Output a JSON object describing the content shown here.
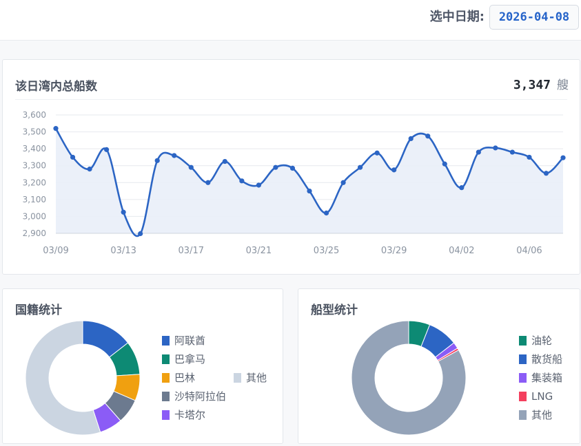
{
  "header": {
    "date_label": "选中日期:",
    "date_value": "2026-04-08"
  },
  "main_panel": {
    "title": "该日湾内总船数",
    "count": "3,347",
    "count_unit": "艘"
  },
  "nationality_panel": {
    "title": "国籍统计",
    "legend": [
      {
        "label": "阿联酋",
        "color": "#2c65c4"
      },
      {
        "label": "巴拿马",
        "color": "#0d8a74"
      },
      {
        "label": "巴林",
        "color": "#f0a010"
      },
      {
        "label": "沙特阿拉伯",
        "color": "#6c7a8f"
      },
      {
        "label": "卡塔尔",
        "color": "#8b5cf6"
      },
      {
        "label": "其他",
        "color": "#cbd5e1"
      }
    ]
  },
  "type_panel": {
    "title": "船型统计",
    "legend": [
      {
        "label": "油轮",
        "color": "#0d8a74"
      },
      {
        "label": "散货船",
        "color": "#2c65c4"
      },
      {
        "label": "集装箱",
        "color": "#8b5cf6"
      },
      {
        "label": "LNG",
        "color": "#f43f5e"
      },
      {
        "label": "其他",
        "color": "#94a3b8"
      }
    ]
  },
  "chart_data": [
    {
      "type": "area",
      "title": "该日湾内总船数",
      "x": [
        "03/09",
        "03/10",
        "03/11",
        "03/12",
        "03/13",
        "03/14",
        "03/15",
        "03/16",
        "03/17",
        "03/18",
        "03/19",
        "03/20",
        "03/21",
        "03/22",
        "03/23",
        "03/24",
        "03/25",
        "03/26",
        "03/27",
        "03/28",
        "03/29",
        "03/30",
        "03/31",
        "04/01",
        "04/02",
        "04/03",
        "04/04",
        "04/05",
        "04/06",
        "04/07",
        "04/08"
      ],
      "x_tick_labels": [
        "03/09",
        "03/13",
        "03/17",
        "03/21",
        "03/25",
        "03/29",
        "04/02",
        "04/06"
      ],
      "y_tick_labels": [
        "2,900",
        "3,000",
        "3,100",
        "3,200",
        "3,300",
        "3,400",
        "3,500",
        "3,600"
      ],
      "series": [
        {
          "values": [
            3520,
            3350,
            3280,
            3395,
            3025,
            2898,
            3330,
            3360,
            3290,
            3200,
            3325,
            3210,
            3185,
            3290,
            3285,
            3150,
            3020,
            3200,
            3290,
            3375,
            3275,
            3460,
            3475,
            3310,
            3170,
            3380,
            3405,
            3380,
            3350,
            3255,
            3347
          ]
        }
      ],
      "ylim": [
        2900,
        3600
      ],
      "grid": true,
      "color": "#2c65c4"
    },
    {
      "type": "pie",
      "title": "国籍统计",
      "categories": [
        "阿联酋",
        "巴拿马",
        "巴林",
        "沙特阿拉伯",
        "卡塔尔",
        "其他"
      ],
      "values": [
        14.5,
        9.5,
        7.5,
        7.0,
        6.5,
        55.0
      ],
      "colors": [
        "#2c65c4",
        "#0d8a74",
        "#f0a010",
        "#6c7a8f",
        "#8b5cf6",
        "#cbd5e1"
      ]
    },
    {
      "type": "pie",
      "title": "船型统计",
      "categories": [
        "油轮",
        "散货船",
        "集装箱",
        "LNG",
        "其他"
      ],
      "values": [
        6.0,
        8.5,
        1.8,
        0.6,
        83.1
      ],
      "colors": [
        "#0d8a74",
        "#2c65c4",
        "#8b5cf6",
        "#f43f5e",
        "#94a3b8"
      ]
    }
  ]
}
